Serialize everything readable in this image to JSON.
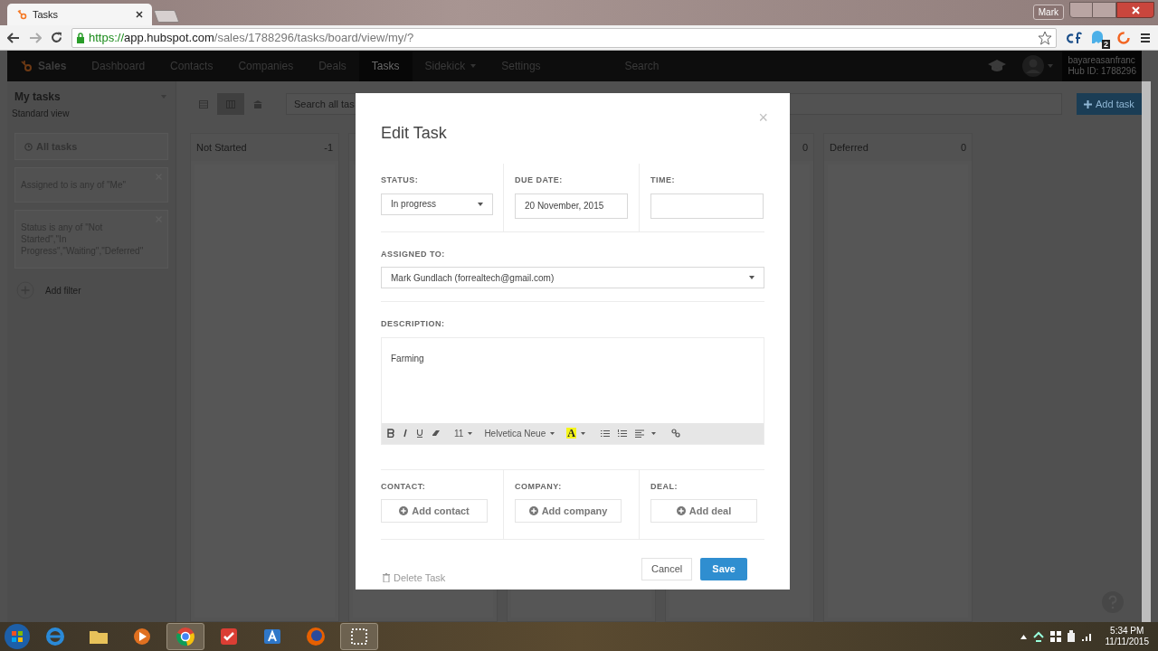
{
  "browser": {
    "tab": {
      "title": "Tasks"
    },
    "user": "Mark",
    "url": {
      "scheme": "https://",
      "host": "app.hubspot.com",
      "path": "/sales/1788296/tasks/board/view/my/?"
    },
    "extension_badge": "2"
  },
  "nav": {
    "brand": "Sales",
    "items": [
      {
        "label": "Dashboard",
        "selected": false,
        "dropdown": false
      },
      {
        "label": "Contacts",
        "selected": false,
        "dropdown": false
      },
      {
        "label": "Companies",
        "selected": false,
        "dropdown": false
      },
      {
        "label": "Deals",
        "selected": false,
        "dropdown": false
      },
      {
        "label": "Tasks",
        "selected": true,
        "dropdown": false
      },
      {
        "label": "Sidekick",
        "selected": false,
        "dropdown": true
      },
      {
        "label": "Settings",
        "selected": false,
        "dropdown": false
      }
    ],
    "search": {
      "placeholder": "Search"
    },
    "account": "bayareasanfranc",
    "hub_id": "Hub ID: 1788296"
  },
  "sidebar": {
    "title": "My tasks",
    "view": "Standard view",
    "all_tasks": "All tasks",
    "filters": [
      "Assigned to is any of \"Me\"",
      "Status is any of \"Not Started\",\"In Progress\",\"Waiting\",\"Deferred\""
    ],
    "add_filter": "Add filter"
  },
  "board": {
    "views": [
      {
        "selected": false
      },
      {
        "selected": true
      },
      {
        "selected": false
      }
    ],
    "search": {
      "placeholder": "Search all tas"
    },
    "add_task": "Add task",
    "columns": [
      {
        "title": "Not Started",
        "count": "-1"
      },
      {
        "count": "0"
      },
      {
        "title": "Deferred",
        "count": "0"
      }
    ]
  },
  "modal": {
    "title": "Edit Task",
    "close": "×",
    "status": {
      "label": "STATUS:",
      "value": "In progress"
    },
    "due_date": {
      "label": "DUE DATE:",
      "value": "20 November, 2015"
    },
    "time": {
      "label": "TIME:"
    },
    "assigned_to": {
      "label": "ASSIGNED TO:",
      "value": "Mark Gundlach (forrealtech@gmail.com)"
    },
    "description": {
      "label": "DESCRIPTION:",
      "value": "Farming"
    },
    "toolbar": {
      "font_size": "11",
      "font": "Helvetica Neue",
      "text_color": "A"
    },
    "associations": [
      {
        "label": "CONTACT:",
        "button": "Add contact"
      },
      {
        "label": "COMPANY:",
        "button": "Add company"
      },
      {
        "label": "DEAL:",
        "button": "Add deal"
      }
    ],
    "delete": "Delete Task",
    "cancel": "Cancel",
    "save": "Save"
  },
  "taskbar": {
    "time": "5:34 PM",
    "date": "11/11/2015"
  }
}
